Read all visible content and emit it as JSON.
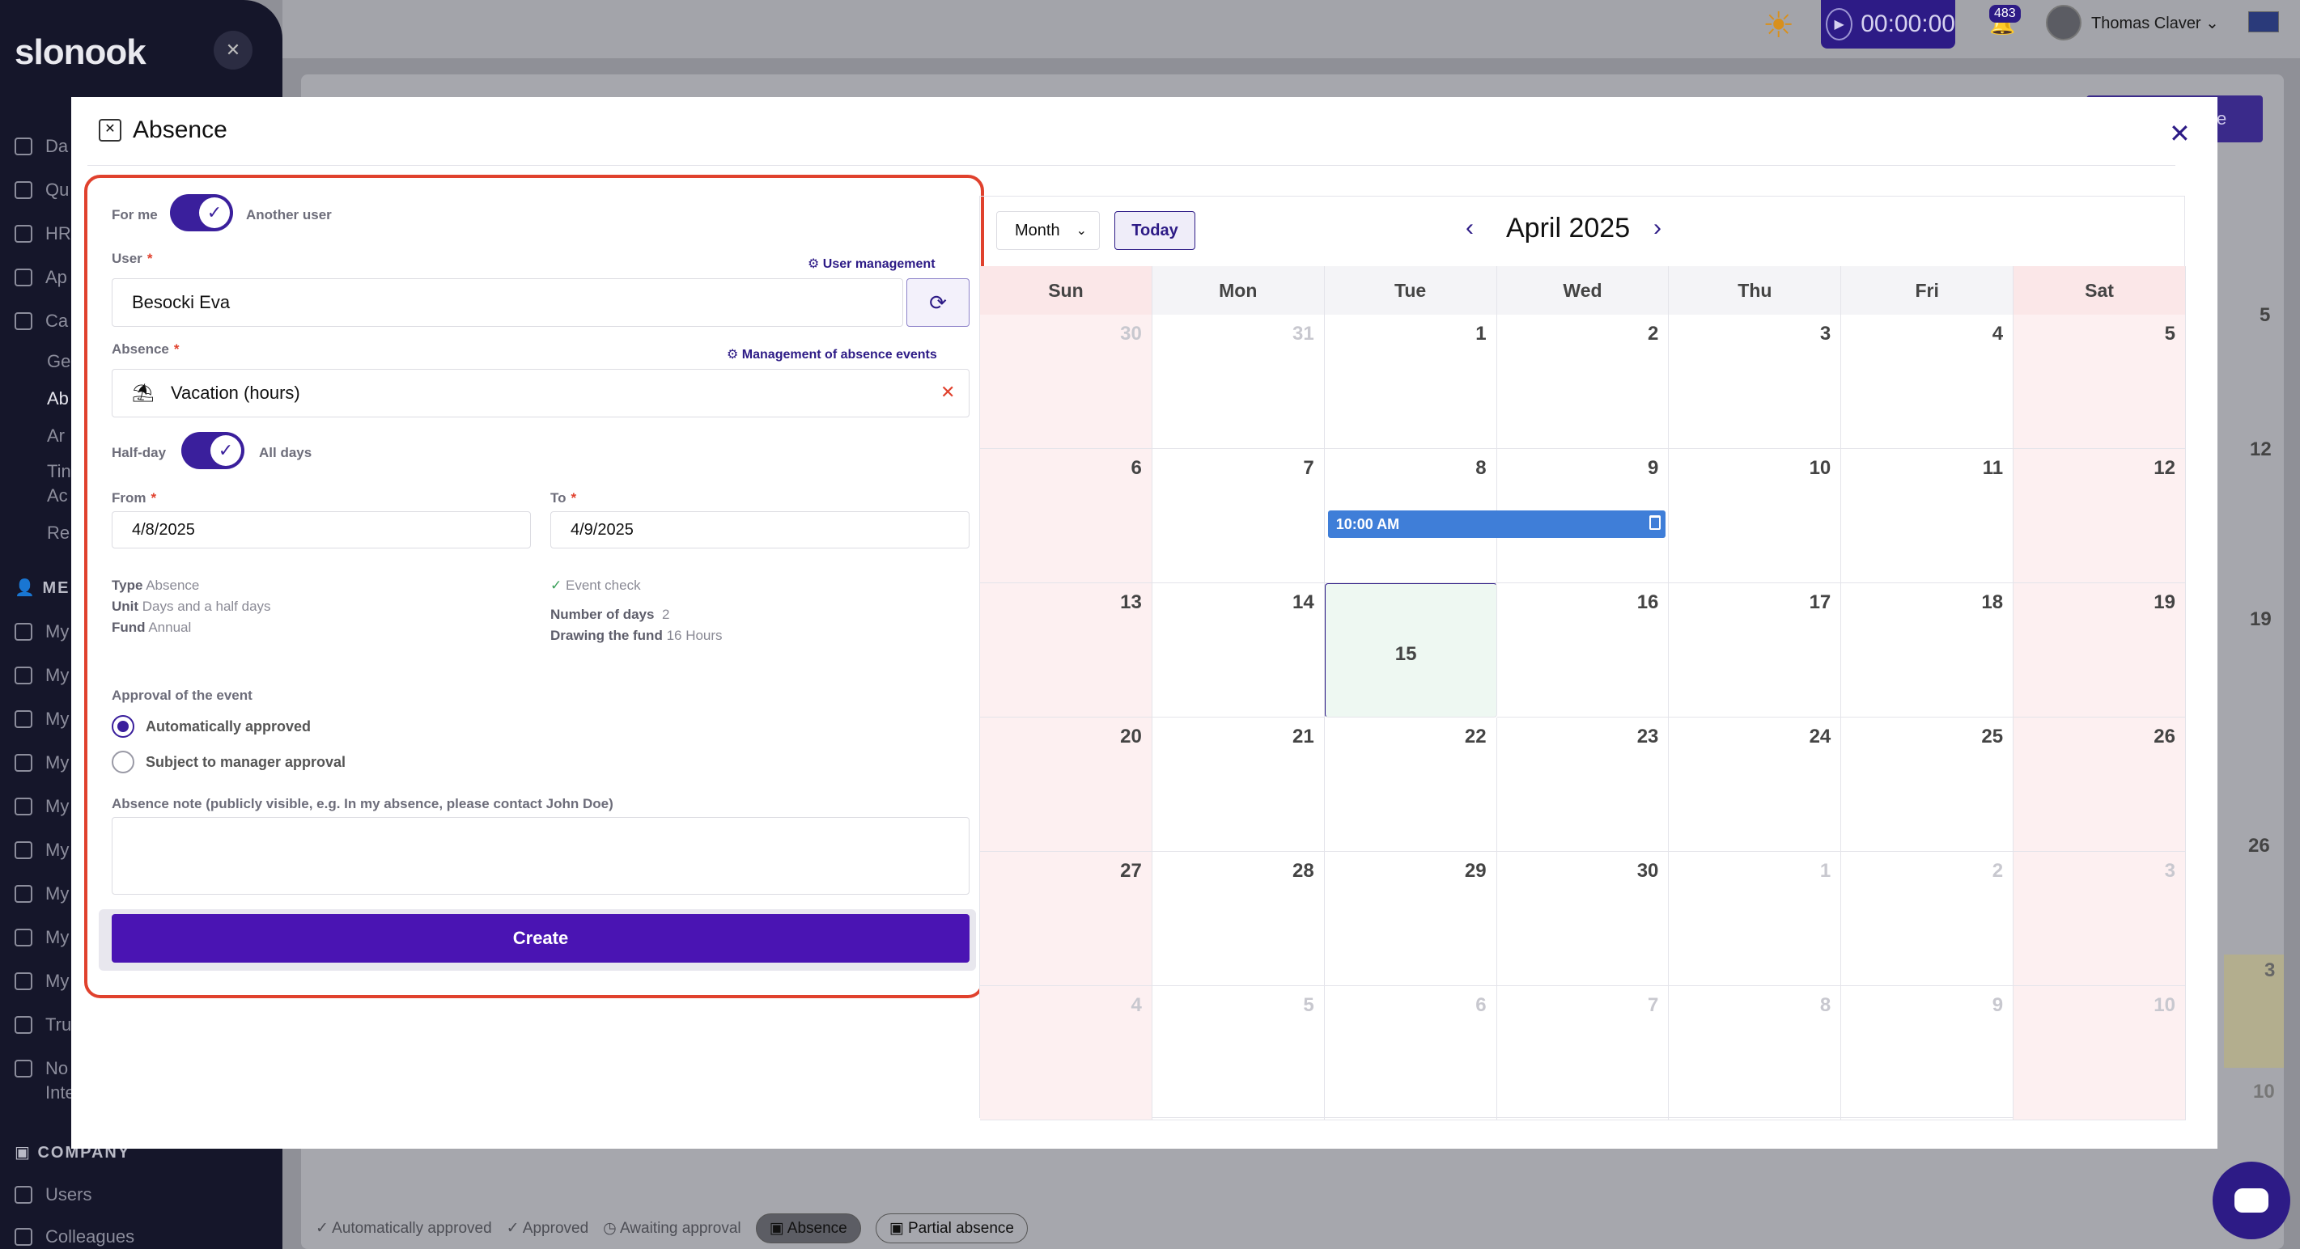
{
  "app": {
    "logo": "slonook",
    "timer": "00:00:00",
    "notification_count": "483",
    "user_name": "Thomas Claver",
    "sidebar": {
      "items": [
        "Da",
        "Qu",
        "HR",
        "Ap",
        "Ca",
        "Ge",
        "Ab",
        "Ar",
        "Tin",
        "Ac",
        "Re"
      ],
      "section_me": "ME",
      "me_items": [
        "My",
        "My",
        "My",
        "My",
        "My",
        "My",
        "My",
        "My",
        "My",
        "Tru",
        "No",
        "Inte"
      ],
      "section_company": "COMPANY",
      "company_items": [
        "Users",
        "Colleagues"
      ]
    },
    "legend": [
      "Automatically approved",
      "Approved",
      "Awaiting approval",
      "Absence",
      "Partial absence"
    ],
    "bg_right_numbers": [
      "5",
      "12",
      "19",
      "26",
      "3",
      "10"
    ],
    "bg_button_text": "ce"
  },
  "modal": {
    "title": "Absence",
    "form": {
      "for_me": "For me",
      "another_user": "Another user",
      "user_label": "User",
      "user_management": "User management",
      "user_value": "Besocki Eva",
      "absence_label": "Absence",
      "absence_management": "Management of absence events",
      "absence_value": "Vacation (hours)",
      "half_day": "Half-day",
      "all_days": "All days",
      "from_label": "From",
      "from_value": "4/8/2025",
      "to_label": "To",
      "to_value": "4/9/2025",
      "type_label": "Type",
      "type_value": "Absence",
      "unit_label": "Unit",
      "unit_value": "Days and a half days",
      "fund_label": "Fund",
      "fund_value": "Annual",
      "event_check": "Event check",
      "num_days_label": "Number of days",
      "num_days_value": "2",
      "drawing_label": "Drawing the fund",
      "drawing_value": "16 Hours",
      "approval_label": "Approval of the event",
      "approval_options": [
        "Automatically approved",
        "Subject to manager approval"
      ],
      "note_label": "Absence note (publicly visible, e.g. In my absence, please contact John Doe)",
      "note_value": "",
      "create_button": "Create"
    },
    "calendar": {
      "view": "Month",
      "today": "Today",
      "month_title": "April 2025",
      "weekdays": [
        "Sun",
        "Mon",
        "Tue",
        "Wed",
        "Thu",
        "Fri",
        "Sat"
      ],
      "weeks": [
        [
          "30",
          "31",
          "1",
          "2",
          "3",
          "4",
          "5"
        ],
        [
          "6",
          "7",
          "8",
          "9",
          "10",
          "11",
          "12"
        ],
        [
          "13",
          "14",
          "15",
          "16",
          "17",
          "18",
          "19"
        ],
        [
          "20",
          "21",
          "22",
          "23",
          "24",
          "25",
          "26"
        ],
        [
          "27",
          "28",
          "29",
          "30",
          "1",
          "2",
          "3"
        ],
        [
          "4",
          "5",
          "6",
          "7",
          "8",
          "9",
          "10"
        ]
      ],
      "event_label": "10:00 AM"
    }
  }
}
